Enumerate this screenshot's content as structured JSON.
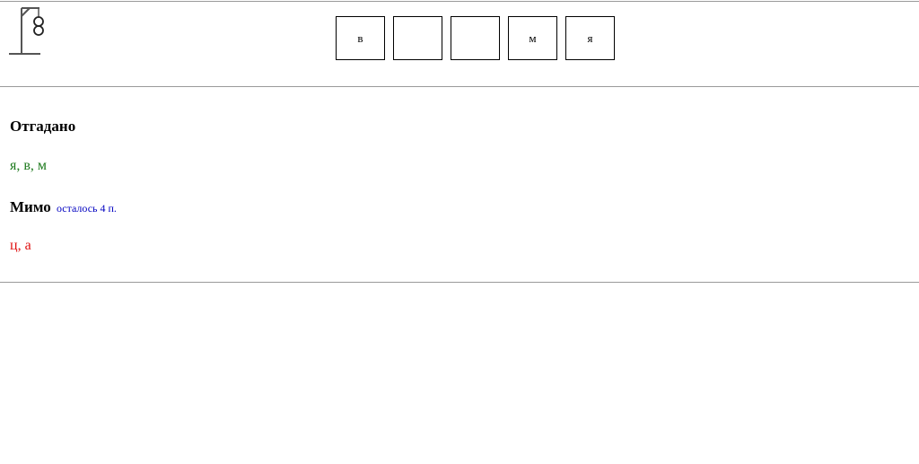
{
  "game": {
    "word_cells": [
      "в",
      "",
      "",
      "м",
      "я"
    ],
    "guessed": {
      "heading": "Отгадано",
      "letters": "я, в, м",
      "color": "#1e7a1e"
    },
    "missed": {
      "heading": "Мимо",
      "remaining": "осталось 4 п.",
      "letters": "ц, а",
      "color": "#e01010"
    },
    "hangman_stage_icon": "gallows-head-body-icon"
  }
}
